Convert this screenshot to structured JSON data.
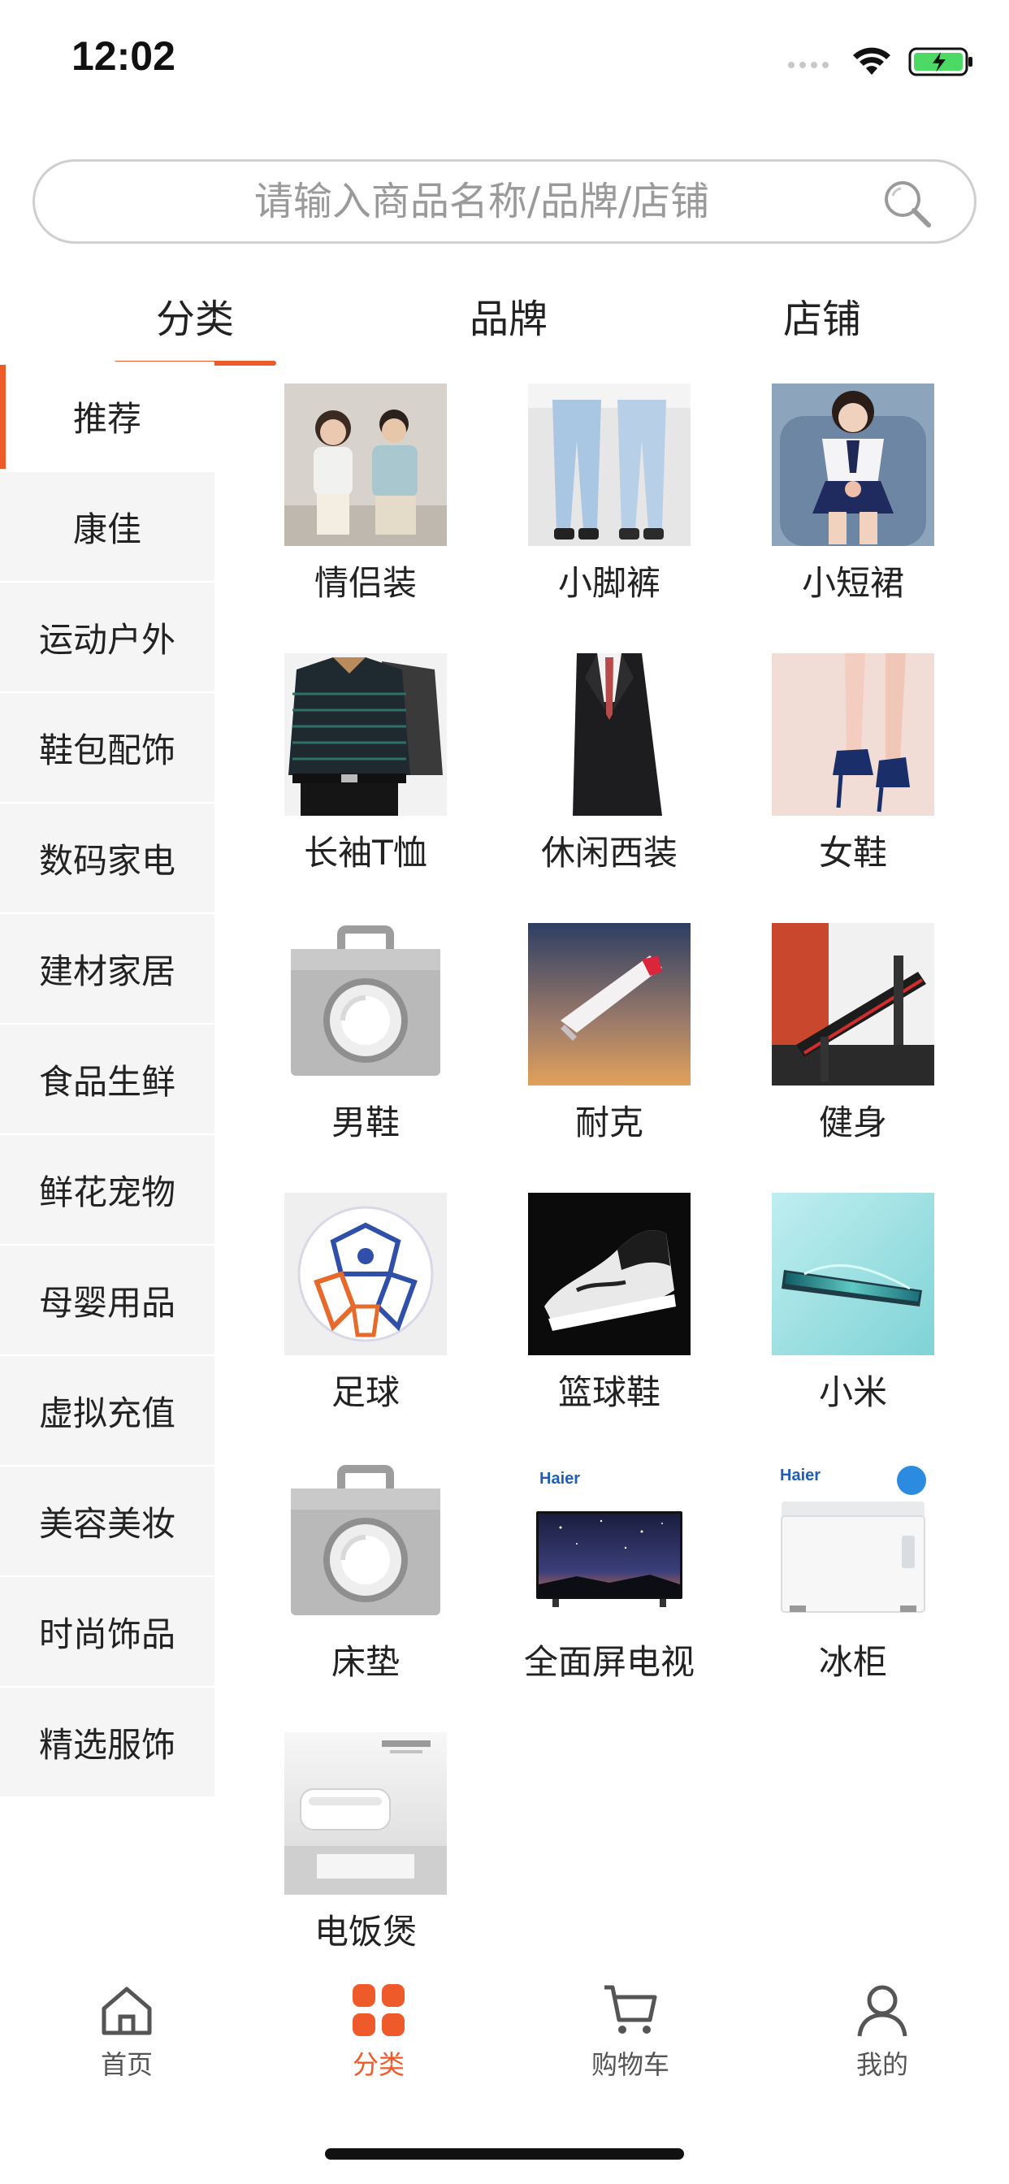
{
  "status_bar": {
    "time": "12:02"
  },
  "search": {
    "placeholder": "请输入商品名称/品牌/店铺"
  },
  "top_tabs": [
    {
      "label": "分类",
      "active": true
    },
    {
      "label": "品牌",
      "active": false
    },
    {
      "label": "店铺",
      "active": false
    }
  ],
  "sidebar": {
    "items": [
      {
        "label": "推荐",
        "active": true
      },
      {
        "label": "康佳"
      },
      {
        "label": "运动户外"
      },
      {
        "label": "鞋包配饰"
      },
      {
        "label": "数码家电"
      },
      {
        "label": "建材家居"
      },
      {
        "label": "食品生鲜"
      },
      {
        "label": "鲜花宠物"
      },
      {
        "label": "母婴用品"
      },
      {
        "label": "虚拟充值"
      },
      {
        "label": "美容美妆"
      },
      {
        "label": "时尚饰品"
      },
      {
        "label": "精选服饰"
      }
    ]
  },
  "categories": [
    {
      "label": "情侣装",
      "icon": "couple-clothing-photo"
    },
    {
      "label": "小脚裤",
      "icon": "skinny-jeans-photo"
    },
    {
      "label": "小短裙",
      "icon": "short-skirt-photo"
    },
    {
      "label": "长袖T恤",
      "icon": "long-sleeve-tshirt-photo"
    },
    {
      "label": "休闲西装",
      "icon": "casual-suit-photo"
    },
    {
      "label": "女鞋",
      "icon": "womens-shoes-photo"
    },
    {
      "label": "男鞋",
      "icon": "camera-placeholder-icon"
    },
    {
      "label": "耐克",
      "icon": "nike-shoe-photo"
    },
    {
      "label": "健身",
      "icon": "fitness-bench-photo"
    },
    {
      "label": "足球",
      "icon": "football-photo"
    },
    {
      "label": "篮球鞋",
      "icon": "basketball-shoe-photo"
    },
    {
      "label": "小米",
      "icon": "xiaomi-phone-photo"
    },
    {
      "label": "床垫",
      "icon": "camera-placeholder-icon"
    },
    {
      "label": "全面屏电视",
      "icon": "tv-photo"
    },
    {
      "label": "冰柜",
      "icon": "freezer-photo"
    },
    {
      "label": "电饭煲",
      "icon": "rice-cooker-photo"
    }
  ],
  "thumb_brand_text": {
    "tv": "Haier",
    "freezer": "Haier"
  },
  "bottom_nav": [
    {
      "label": "首页",
      "icon": "home-icon",
      "active": false
    },
    {
      "label": "分类",
      "icon": "category-grid-icon",
      "active": true
    },
    {
      "label": "购物车",
      "icon": "cart-icon",
      "active": false
    },
    {
      "label": "我的",
      "icon": "profile-icon",
      "active": false
    }
  ],
  "colors": {
    "accent": "#ee5a2a",
    "sidebar_bg": "#f5f5f5",
    "text": "#222222",
    "battery": "#4cd964"
  }
}
